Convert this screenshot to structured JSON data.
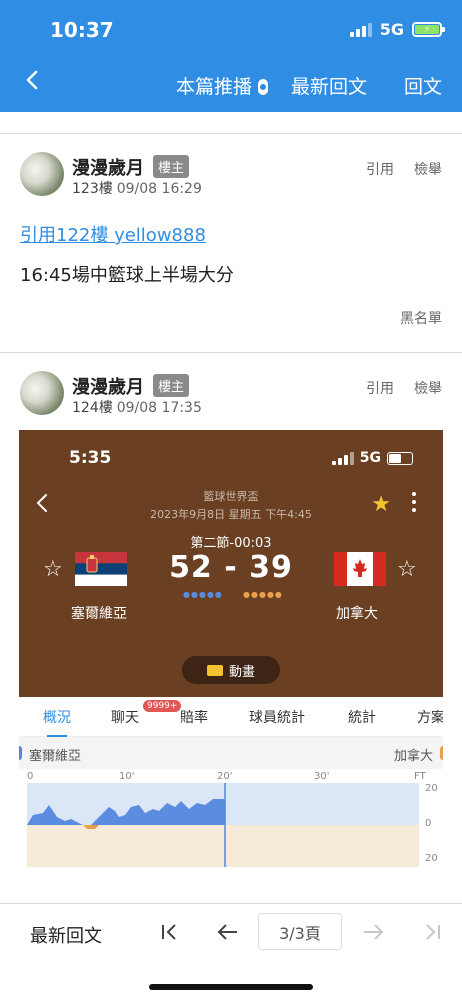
{
  "status_bar": {
    "time": "10:37",
    "network": "5G"
  },
  "nav": {
    "broadcast_label": "本篇推播",
    "latest_label": "最新回文",
    "reply_label": "回文"
  },
  "posts": [
    {
      "author": "漫漫歲月",
      "badge": "樓主",
      "floor": "123樓",
      "timestamp": "09/08 16:29",
      "quote_label": "引用",
      "report_label": "檢舉",
      "quote_link": "引用122樓 yellow888",
      "text": "16:45場中籃球上半場大分",
      "blacklist_label": "黑名單"
    },
    {
      "author": "漫漫歲月",
      "badge": "樓主",
      "floor": "124樓",
      "timestamp": "09/08 17:35",
      "quote_label": "引用",
      "report_label": "檢舉"
    }
  ],
  "embedded": {
    "time": "5:35",
    "network": "5G",
    "league": "籃球世界盃",
    "date": "2023年9月8日 星期五 下午4:45",
    "period": "第二節-00:03",
    "home_score": "52",
    "away_score": "39",
    "score_sep": "-",
    "home_team": "塞爾維亞",
    "away_team": "加拿大",
    "animation_label": "動畫",
    "tabs": [
      "概況",
      "聊天",
      "賠率",
      "球員統計",
      "統計",
      "方案"
    ],
    "chat_badge": "9999+",
    "chart_teams": {
      "home": "塞爾維亞",
      "away": "加拿大"
    },
    "chart_x_ticks": [
      "0",
      "10'",
      "20'",
      "30'",
      "FT"
    ],
    "chart_y_ticks": [
      "20",
      "0",
      "20"
    ],
    "colors": {
      "home": "#4f86e0",
      "away": "#e8a04a",
      "header_bg": "#6b3f22"
    }
  },
  "bottom_bar": {
    "latest_label": "最新回文",
    "page_indicator": "3/3頁"
  },
  "colors": {
    "brand": "#2f8de4"
  }
}
